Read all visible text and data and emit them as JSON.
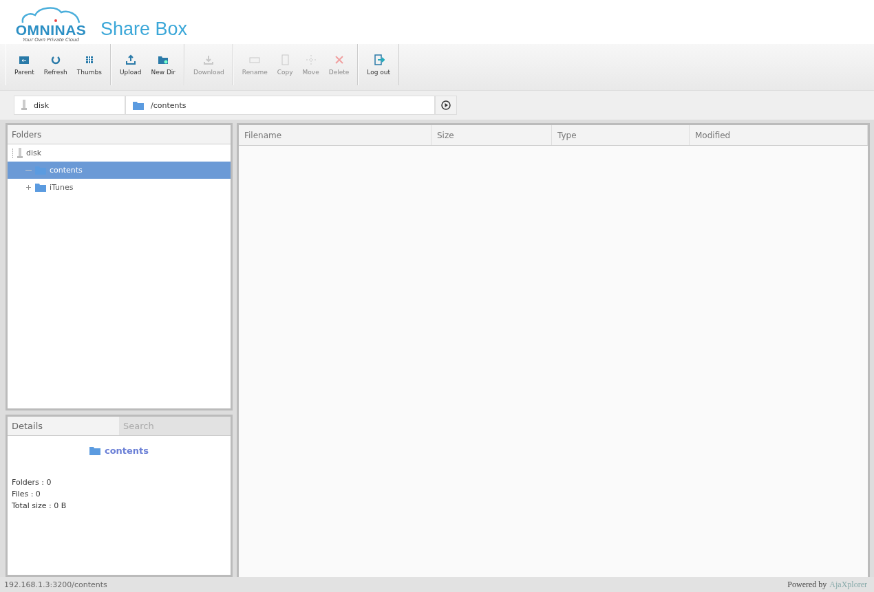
{
  "logo": {
    "brand": "OMNINAS",
    "tagline": "Your Own Private Cloud",
    "title": "Share Box"
  },
  "toolbar": [
    [
      {
        "label": "Parent",
        "kind": "parent",
        "disabled": false
      },
      {
        "label": "Refresh",
        "kind": "refresh",
        "disabled": false
      },
      {
        "label": "Thumbs",
        "kind": "thumbs",
        "disabled": false
      }
    ],
    [
      {
        "label": "Upload",
        "kind": "upload",
        "disabled": false
      },
      {
        "label": "New Dir",
        "kind": "newdir",
        "disabled": false
      }
    ],
    [
      {
        "label": "Download",
        "kind": "download",
        "disabled": true
      }
    ],
    [
      {
        "label": "Rename",
        "kind": "rename",
        "disabled": true
      },
      {
        "label": "Copy",
        "kind": "copy",
        "disabled": true
      },
      {
        "label": "Move",
        "kind": "move",
        "disabled": true
      },
      {
        "label": "Delete",
        "kind": "delete",
        "disabled": true
      }
    ],
    [
      {
        "label": "Log out",
        "kind": "logout",
        "disabled": false
      }
    ]
  ],
  "address": {
    "repository": "disk",
    "path": "/contents"
  },
  "folders": {
    "title": "Folders",
    "tree": [
      {
        "label": "disk",
        "kind": "disk",
        "selected": false,
        "expanded": true,
        "children": [
          {
            "label": "contents",
            "kind": "folder",
            "selected": true
          },
          {
            "label": "iTunes",
            "kind": "folder",
            "selected": false,
            "expanded": false
          }
        ]
      }
    ]
  },
  "details": {
    "tabs": [
      {
        "label": "Details",
        "selected": true
      },
      {
        "label": "Search",
        "selected": false
      }
    ],
    "name": "contents",
    "stats": [
      "Folders : 0",
      "Files : 0",
      "Total size : 0 B"
    ]
  },
  "table": {
    "columns": [
      "Filename",
      "Size",
      "Type",
      "Modified"
    ]
  },
  "status_bar": {
    "url": "192.168.1.3:3200/contents",
    "powered": "Powered by",
    "product": "AjaXplorer"
  }
}
